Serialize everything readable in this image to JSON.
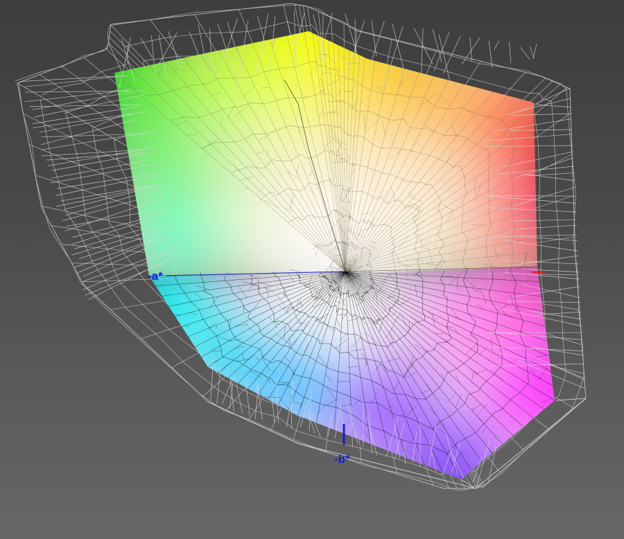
{
  "colors": {
    "background_top": "#3d3d3d",
    "background_bottom": "#676767",
    "mesh_reference": "#d8d8d8",
    "mesh_measured": "#000000",
    "axis_blue": "#1a1ad0",
    "axis_red": "#e02020",
    "gamut_green": "#00e000",
    "gamut_yellow": "#ffff00",
    "gamut_red": "#ff2a1a",
    "gamut_magenta": "#ff3cff",
    "gamut_blue": "#8a4cff",
    "gamut_cyan": "#00f0f0",
    "gamut_white": "#ffffff"
  },
  "axes": {
    "neg_a_label": "-a*",
    "neg_b_label": "-b*"
  }
}
